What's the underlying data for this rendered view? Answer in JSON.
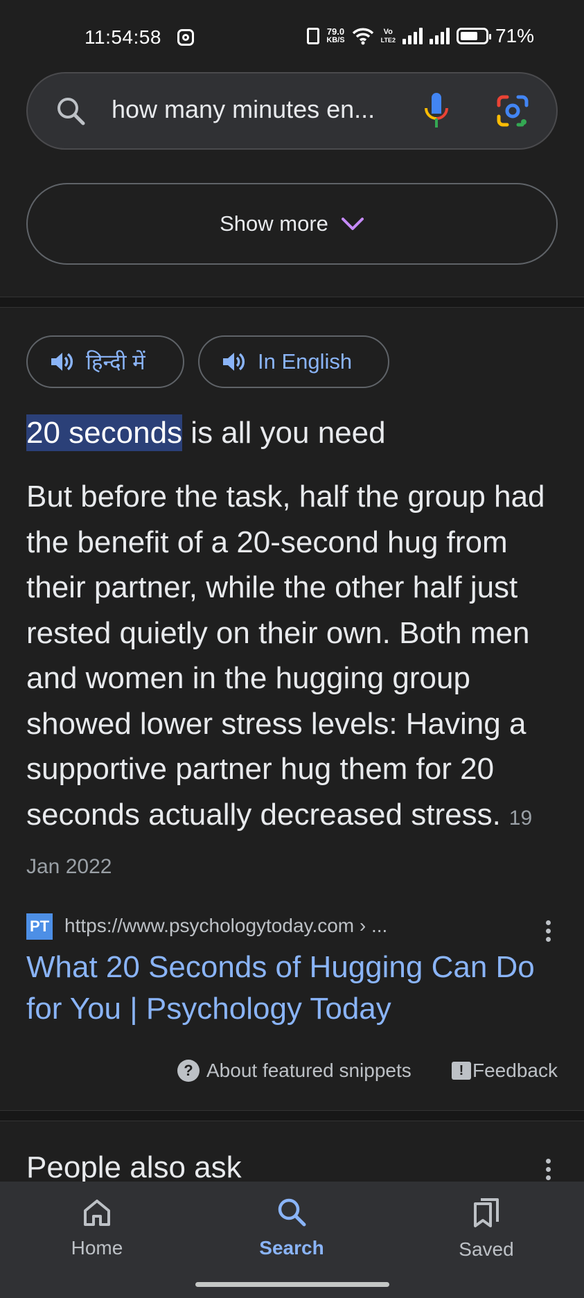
{
  "status_bar": {
    "time": "11:54:58",
    "network_speed_value": "79.0",
    "network_speed_unit": "KB/S",
    "volte_top": "Vo",
    "volte_bottom": "LTE2",
    "battery_percent": "71%",
    "battery_level": 0.71
  },
  "search": {
    "query": "how many minutes en..."
  },
  "show_more": {
    "label": "Show more"
  },
  "language_chips": [
    {
      "label": "हिन्दी में"
    },
    {
      "label": "In English"
    }
  ],
  "featured_snippet": {
    "answer_highlight": "20 seconds",
    "answer_rest": " is all you need",
    "text": "But before the task, half the group had the benefit of a 20-second hug from their partner, while the other half just rested quietly on their own. Both men and women in the hugging group showed lower stress levels: Having a supportive partner hug them for 20 seconds actually decreased stress.",
    "date": "19 Jan 2022",
    "source": {
      "favicon_text": "PT",
      "url": "https://www.psychologytoday.com › ...",
      "title": "What 20 Seconds of Hugging Can Do for You | Psychology Today"
    },
    "about_label": "About featured snippets",
    "feedback_label": "Feedback"
  },
  "people_also_ask": {
    "heading": "People also ask"
  },
  "bottom_nav": {
    "items": [
      {
        "label": "Home",
        "icon": "home-icon",
        "active": false
      },
      {
        "label": "Search",
        "icon": "search-icon",
        "active": true
      },
      {
        "label": "Saved",
        "icon": "bookmarks-icon",
        "active": false
      }
    ]
  },
  "colors": {
    "background": "#1f1f1f",
    "link": "#8ab4f8",
    "highlight": "#2b4078",
    "nav_background": "#303134"
  }
}
